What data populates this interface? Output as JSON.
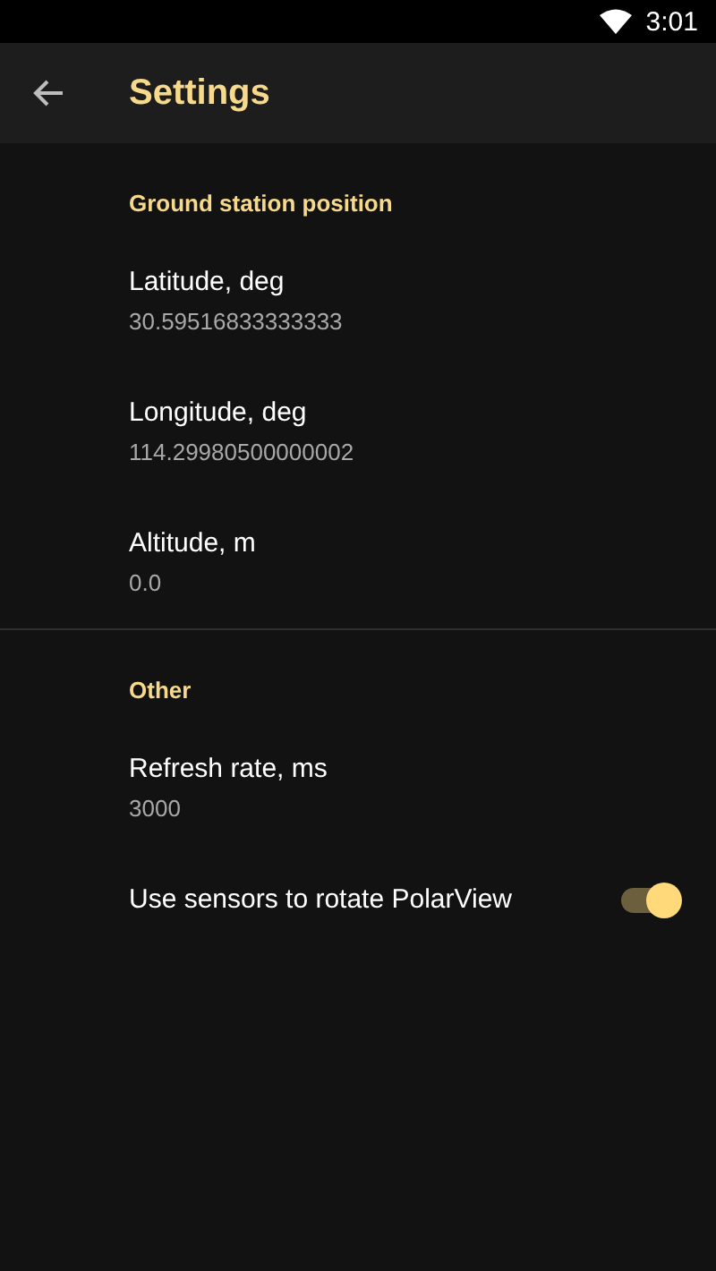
{
  "status_bar": {
    "time": "3:01"
  },
  "app_bar": {
    "title": "Settings"
  },
  "sections": [
    {
      "title": "Ground station position",
      "items": [
        {
          "kind": "text",
          "title": "Latitude, deg",
          "summary": "30.59516833333333"
        },
        {
          "kind": "text",
          "title": "Longitude, deg",
          "summary": "114.29980500000002"
        },
        {
          "kind": "text",
          "title": "Altitude, m",
          "summary": "0.0"
        }
      ]
    },
    {
      "title": "Other",
      "items": [
        {
          "kind": "text",
          "title": "Refresh rate, ms",
          "summary": "3000"
        },
        {
          "kind": "switch",
          "title": "Use sensors to rotate PolarView",
          "on": true
        }
      ]
    }
  ]
}
